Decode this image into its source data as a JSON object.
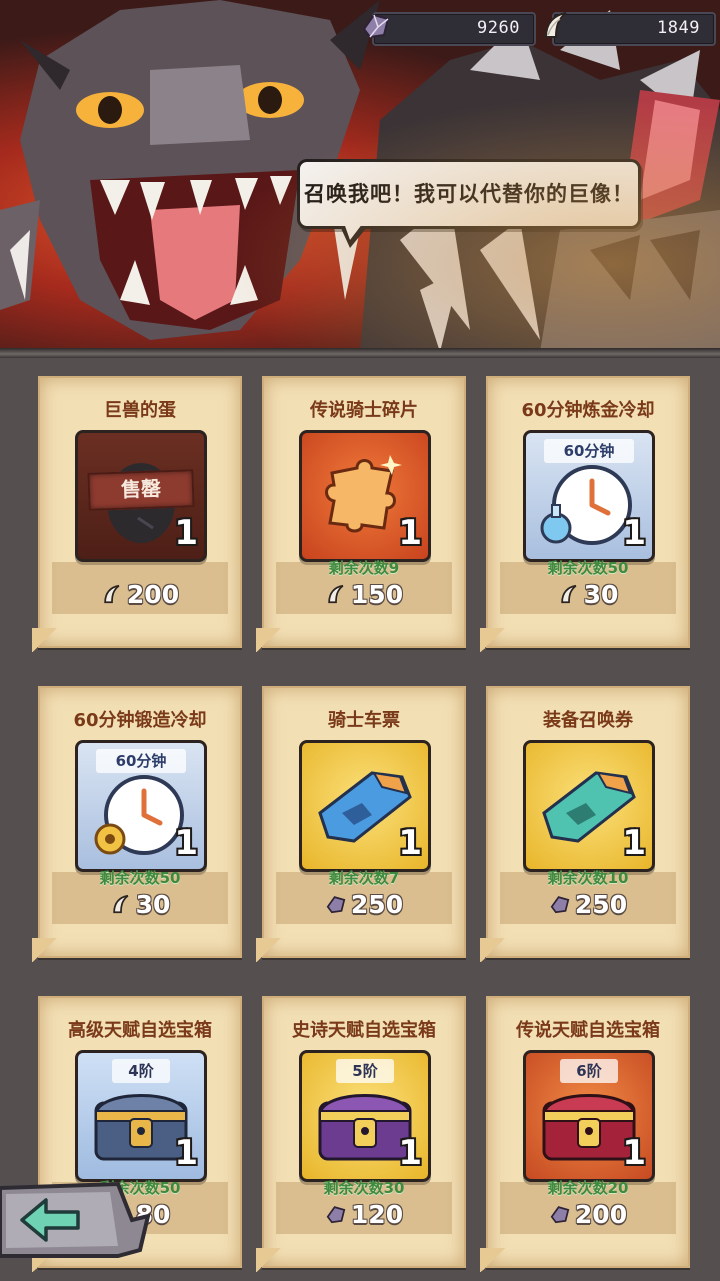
{
  "currencies": [
    {
      "icon": "purple-crystal-icon",
      "value": "9260"
    },
    {
      "icon": "claw-tooth-icon",
      "value": "1849"
    }
  ],
  "speech": "召唤我吧！我可以代替你的巨像！",
  "items": [
    {
      "title": "巨兽的蛋",
      "tag": "",
      "badge": "售罄",
      "qty": "1",
      "remaining": "",
      "price": "200",
      "currency": "claw-tooth-icon",
      "art": "egg"
    },
    {
      "title": "传说骑士碎片",
      "tag": "",
      "badge": "",
      "qty": "1",
      "remaining": "剩余次数9",
      "price": "150",
      "currency": "claw-tooth-icon",
      "art": "puzzle"
    },
    {
      "title": "60分钟炼金冷却",
      "tag": "60分钟",
      "badge": "",
      "qty": "1",
      "remaining": "剩余次数50",
      "price": "30",
      "currency": "claw-tooth-icon",
      "art": "clock-potion"
    },
    {
      "title": "60分钟锻造冷却",
      "tag": "60分钟",
      "badge": "",
      "qty": "1",
      "remaining": "剩余次数50",
      "price": "30",
      "currency": "claw-tooth-icon",
      "art": "clock-gear"
    },
    {
      "title": "骑士车票",
      "tag": "",
      "badge": "",
      "qty": "1",
      "remaining": "剩余次数7",
      "price": "250",
      "currency": "purple-crystal-icon",
      "art": "ticket-blue"
    },
    {
      "title": "装备召唤券",
      "tag": "",
      "badge": "",
      "qty": "1",
      "remaining": "剩余次数10",
      "price": "250",
      "currency": "purple-crystal-icon",
      "art": "ticket-green"
    },
    {
      "title": "高级天赋自选宝箱",
      "tag": "4阶",
      "badge": "",
      "qty": "1",
      "remaining": "剩余次数50",
      "price": "80",
      "currency": "purple-crystal-icon",
      "art": "chest-blue"
    },
    {
      "title": "史诗天赋自选宝箱",
      "tag": "5阶",
      "badge": "",
      "qty": "1",
      "remaining": "剩余次数30",
      "price": "120",
      "currency": "purple-crystal-icon",
      "art": "chest-purple"
    },
    {
      "title": "传说天赋自选宝箱",
      "tag": "6阶",
      "badge": "",
      "qty": "1",
      "remaining": "剩余次数20",
      "price": "200",
      "currency": "purple-crystal-icon",
      "art": "chest-red"
    }
  ],
  "colors": {
    "parchment": "#f2dfb4",
    "title_brown": "#7a3a1a",
    "remaining_green": "#3f8a3f",
    "back_button": "#5ec9a8"
  }
}
